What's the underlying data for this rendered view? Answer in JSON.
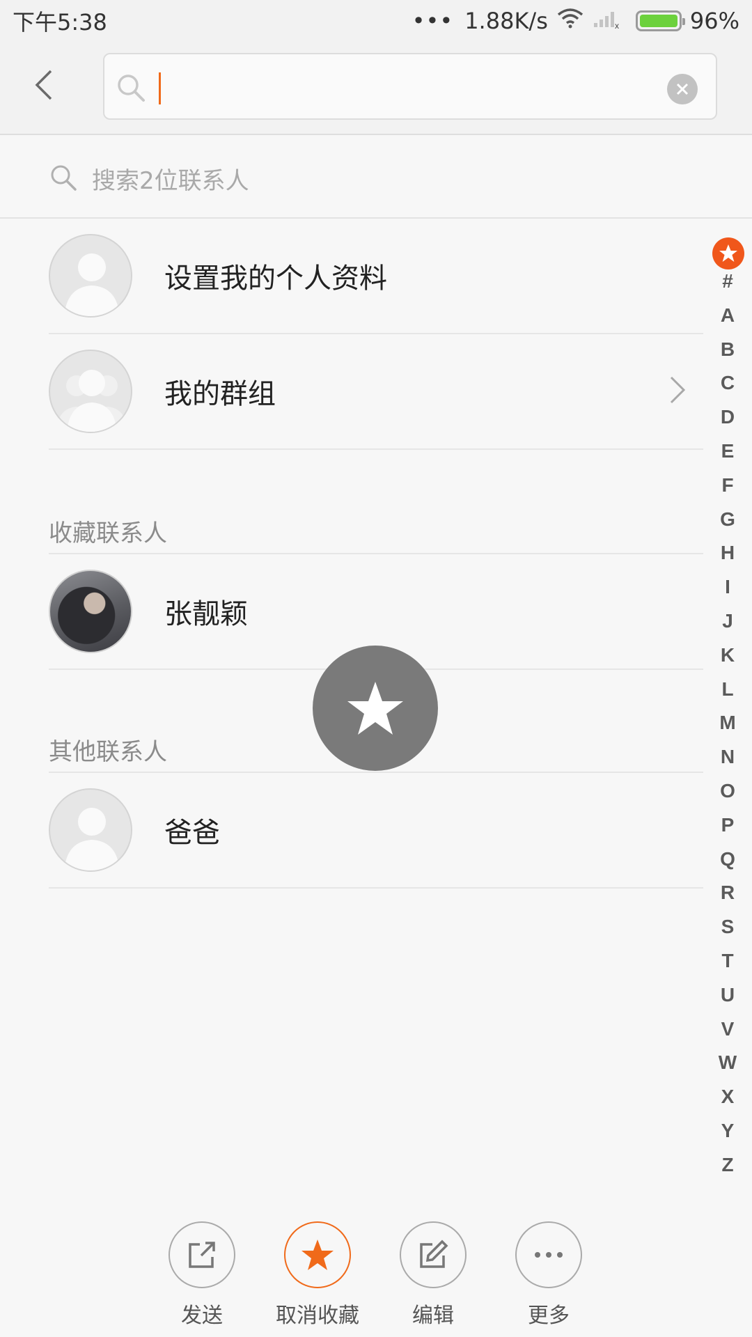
{
  "status_bar": {
    "time": "下午5:38",
    "dots": "•••",
    "speed": "1.88K/s",
    "battery": "96%"
  },
  "search": {
    "value": "",
    "placeholder": ""
  },
  "contact_search": {
    "placeholder": "搜索2位联系人"
  },
  "top_items": [
    {
      "label": "设置我的个人资料"
    },
    {
      "label": "我的群组"
    }
  ],
  "sections": {
    "favorites": {
      "header": "收藏联系人",
      "contacts": [
        {
          "name": "张靓颖"
        }
      ]
    },
    "others": {
      "header": "其他联系人",
      "contacts": [
        {
          "name": "爸爸"
        }
      ]
    }
  },
  "index": {
    "letters": [
      "#",
      "A",
      "B",
      "C",
      "D",
      "E",
      "F",
      "G",
      "H",
      "I",
      "J",
      "K",
      "L",
      "M",
      "N",
      "O",
      "P",
      "Q",
      "R",
      "S",
      "T",
      "U",
      "V",
      "W",
      "X",
      "Y",
      "Z"
    ]
  },
  "actions": [
    {
      "label": "发送",
      "icon": "share-icon"
    },
    {
      "label": "取消收藏",
      "icon": "star-icon"
    },
    {
      "label": "编辑",
      "icon": "edit-icon"
    },
    {
      "label": "更多",
      "icon": "more-icon"
    }
  ],
  "colors": {
    "accent": "#f06a1a",
    "index_star": "#f0571b",
    "battery": "#6cd13c"
  }
}
